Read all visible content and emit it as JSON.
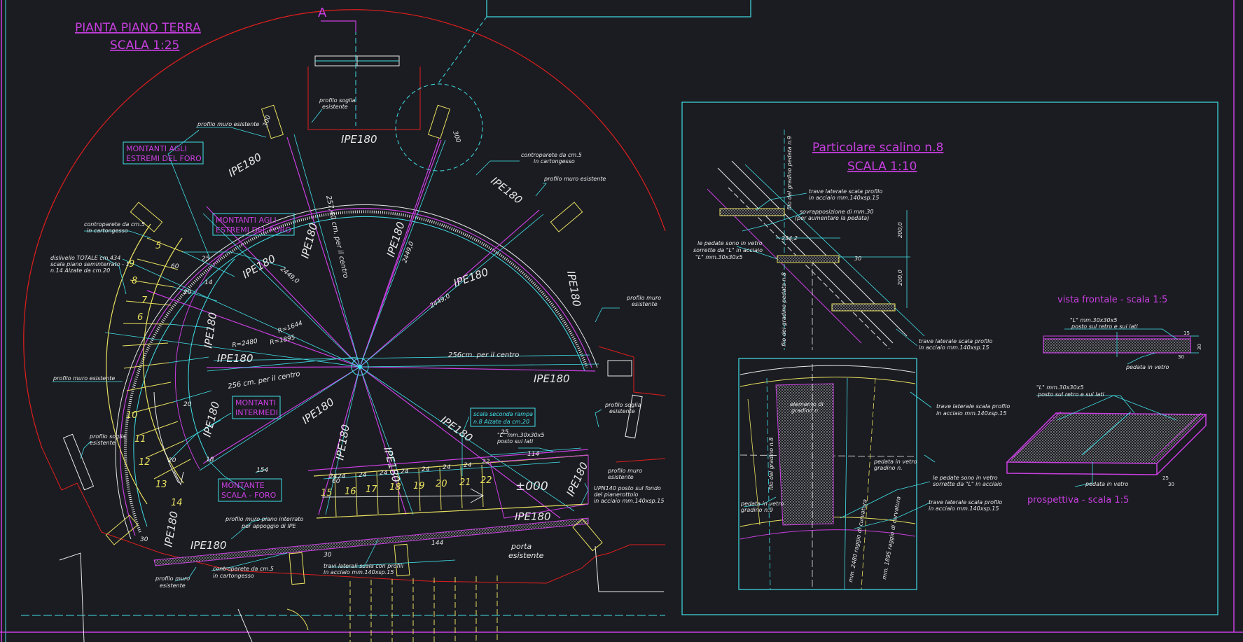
{
  "colors": {
    "background": "#1b1c21",
    "cyan": "#3fe0e8",
    "magenta": "#c83ee0",
    "red": "#e01e1e",
    "white": "#e8e8e8",
    "yellow": "#e8e060"
  },
  "plan": {
    "title": "PIANTA PIANO TERRA",
    "scale": "SCALA 1:25",
    "section_mark": "A",
    "beams": [
      "IPE180",
      "IPE180",
      "IPE180",
      "IPE180",
      "IPE180",
      "IPE180",
      "IPE180",
      "IPE180",
      "IPE180",
      "IPE180",
      "IPE180",
      "IPE180",
      "IPE180",
      "IPE180",
      "IPE180"
    ],
    "boxed_labels": {
      "montanti_1": [
        "MONTANTI AGLI",
        "ESTREMI DEL FORO"
      ],
      "montanti_2": [
        "MONTANTI AGLI",
        "ESTREMI DEL FORO"
      ],
      "montanti_intermedi": [
        "MONTANTI",
        "INTERMEDI"
      ],
      "montante_scala": [
        "MONTANTE",
        "SCALA - FORO"
      ],
      "rampa": [
        "scala seconda rampa",
        "n.8 Alzate da cm.20"
      ]
    },
    "notes": {
      "profilo_soglia_top": [
        "profilo soglia",
        "esistente"
      ],
      "profilo_muro_top": "profilo muro esistente",
      "controparete_tr": [
        "controparete da cm.5",
        "in cartongesso"
      ],
      "profilo_muro_tr": "profilo muro esistente",
      "controparete_l": [
        "controparete da cm.5",
        "in cartongesso"
      ],
      "dislivello": [
        "dislivello TOTALE cm.434",
        "scala piano seminterrato - 1",
        "n.14 Alzate da cm.20"
      ],
      "profilo_muro_r": [
        "profilo muro",
        "esistente"
      ],
      "profilo_muro_l": "profilo muro esistente",
      "profilo_soglia_r": [
        "profilo soglia",
        "esistente"
      ],
      "profilo_soglia_l": [
        "profilo soglia",
        "esistente"
      ],
      "l_angle": [
        "\"L\" mm.30x30x5",
        "posto sui lati"
      ],
      "profilo_muro_r2": [
        "profilo muro",
        "esistente"
      ],
      "upn": [
        "UPN140 posto sul fondo",
        "del pianerottolo",
        "in acciaio mm.140xsp.15"
      ],
      "profilo_muro_interrato": [
        "profilo muro piano interrato",
        "per appoggio di IPE"
      ],
      "controparete_b": [
        "controparete da cm.5",
        "in cartongesso"
      ],
      "profilo_muro_b": [
        "profilo muro",
        "esistente"
      ],
      "travi_laterali": [
        "travi laterali scala con profili",
        "in acciaio mm.140xsp.15"
      ],
      "porta": [
        "porta",
        "esistente"
      ]
    },
    "dims": {
      "d257": "257,40 cm. per il centro",
      "d256": "256cm. per il centro",
      "d256b": "256 cm. per il centro",
      "r1": "2449,0",
      "r2": "2449,0",
      "r3": "2449,0",
      "R1644": "R=1644",
      "R1895": "R=1895",
      "R2480": "R=2480",
      "d300a": "300",
      "d300b": "300",
      "d154": "154",
      "d114": "114",
      "d144": "144",
      "d60": "60",
      "d30": "30",
      "d25": "25",
      "d22": "22",
      "level": "±000"
    },
    "step_numbers": [
      "5",
      "6",
      "7",
      "8",
      "9",
      "10",
      "11",
      "12",
      "13",
      "14",
      "15",
      "16",
      "17",
      "18",
      "19",
      "20",
      "21",
      "22"
    ],
    "tread_dims": [
      "24",
      "24",
      "24",
      "24",
      "24",
      "24",
      "24",
      "24",
      "20",
      "20",
      "25",
      "60",
      "20",
      "18",
      "14"
    ]
  },
  "detail": {
    "title": "Particolare scalino n.8",
    "scale": "SCALA 1:10",
    "notes": {
      "trave_top": [
        "trave laterale scala profilo",
        "in acciaio mm.140xsp.15"
      ],
      "sovrapposizione": [
        "sovrapposizione di mm.30",
        "(per aumentare la pedata)"
      ],
      "pedate_vetro": [
        "le pedate sono in vetro",
        "sorrette da \"L\" in acciaio",
        "\"L\" mm.30x30x5"
      ],
      "trave_mid": [
        "trave laterale scala profilo",
        "in acciaio mm.140xsp.15"
      ],
      "trave_r": [
        "trave laterale scala profilo",
        "in acciaio mm.140xsp.15"
      ],
      "pedata_vetro_r": [
        "pedata in vetro",
        "gradino n."
      ],
      "pedate_sorrette": [
        "le pedate sono in vetro",
        "sorrette da \"L\" in acciaio"
      ],
      "trave_low": [
        "trave laterale scala profilo",
        "in acciaio mm.140xsp.15"
      ],
      "pedata_vetro_9": [
        "pedata in vetro",
        "gradino n.9"
      ],
      "elemento": [
        "elemento di",
        "gradino n."
      ],
      "filo_top": "filo del gradino pedata n.9",
      "filo_mid": "filo del gradino pedata n.8",
      "filo_low": "filo del gradino n.8"
    },
    "dims": {
      "d2342": "234,2",
      "d2000a": "200,0",
      "d2000b": "200,0",
      "d30": "30",
      "r2480": "mm. 2480 raggio di curvatura",
      "r1895": "mm. 1895 raggio di curvatura"
    }
  },
  "views": {
    "frontal_title": "vista frontale - scala 1:5",
    "frontal_l": [
      "\"L\" mm.30x30x5",
      "posto sul retro e sui lati"
    ],
    "frontal_pedata": "pedata in vetro",
    "persp_l": [
      "\"L\" mm.30x30x5",
      "posto sul retro e sui lati"
    ],
    "persp_pedata": "pedata in vetro",
    "persp_title": "prospettiva - scala 1:5",
    "dims": [
      "15",
      "30",
      "30",
      "25",
      "30"
    ]
  }
}
